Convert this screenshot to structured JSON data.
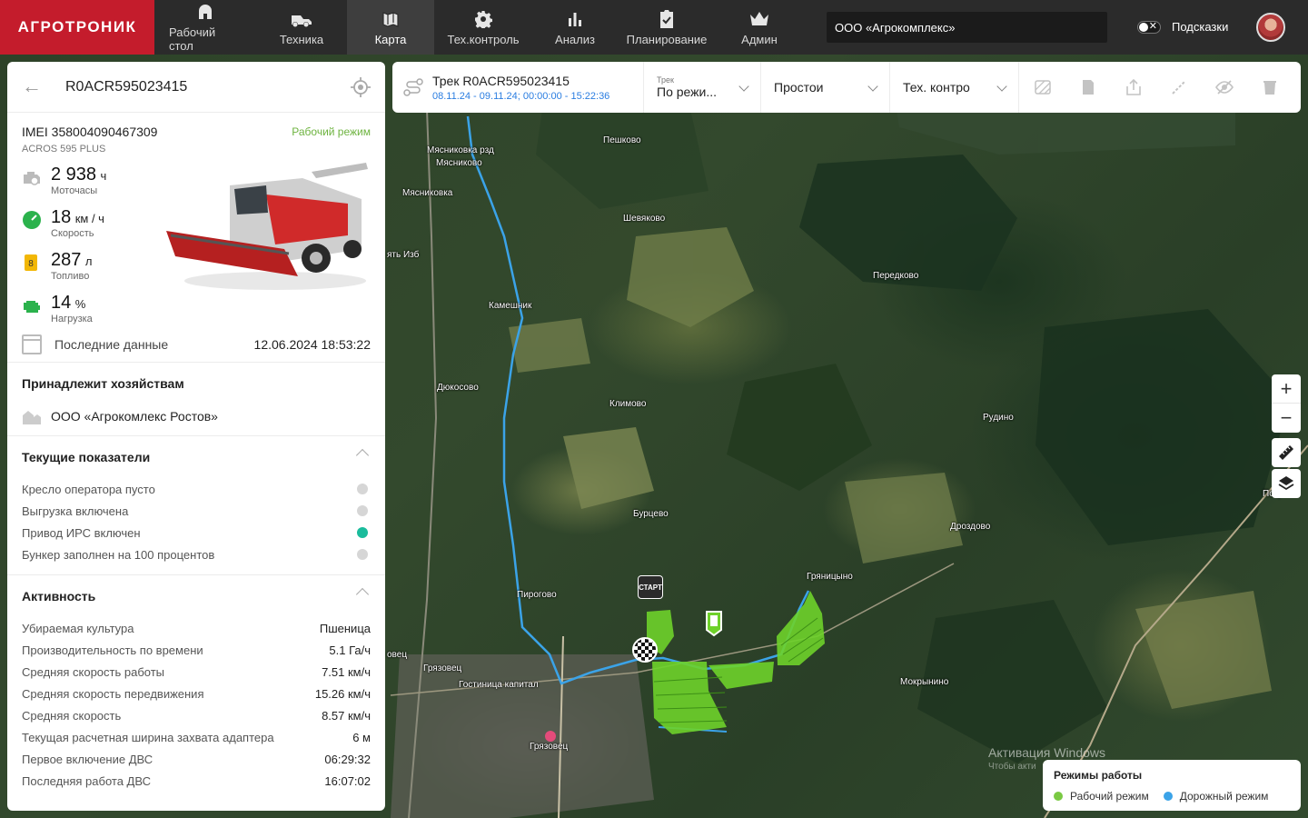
{
  "app": {
    "logo": "АГРОТРОНИК",
    "brand_color": "#c41c2c"
  },
  "nav": [
    {
      "label": "Рабочий стол",
      "icon": "home-icon",
      "active": false
    },
    {
      "label": "Техника",
      "icon": "tractor-icon",
      "active": false
    },
    {
      "label": "Карта",
      "icon": "map-icon",
      "active": true
    },
    {
      "label": "Тех.контроль",
      "icon": "gear-icon",
      "active": false
    },
    {
      "label": "Анализ",
      "icon": "bar-chart-icon",
      "active": false
    },
    {
      "label": "Планирование",
      "icon": "clipboard-check-icon",
      "active": false
    },
    {
      "label": "Админ",
      "icon": "crown-icon",
      "active": false
    }
  ],
  "header": {
    "company": "ООО «Агрокомплекс»",
    "hints_label": "Подсказки",
    "hints_enabled": false
  },
  "vehicle": {
    "title": "R0ACR595023415",
    "imei": "IMEI 358004090467309",
    "model": "ACROS 595 PLUS",
    "mode": "Рабочий режим",
    "stats": [
      {
        "value": "2 938",
        "unit": "ч",
        "label": "Моточасы",
        "icon": "engine-hours-icon"
      },
      {
        "value": "18",
        "unit": "км / ч",
        "label": "Скорость",
        "icon": "speedometer-icon"
      },
      {
        "value": "287",
        "unit": "л",
        "label": "Топливо",
        "icon": "fuel-icon"
      },
      {
        "value": "14",
        "unit": "%",
        "label": "Нагрузка",
        "icon": "engine-load-icon"
      }
    ],
    "last_data_label": "Последние данные",
    "last_data_value": "12.06.2024 18:53:22"
  },
  "farms": {
    "title": "Принадлежит хозяйствам",
    "items": [
      "ООО «Агрокомлекс Ростов»"
    ]
  },
  "indicators": {
    "title": "Текущие показатели",
    "items": [
      {
        "label": "Кресло оператора пусто",
        "on": false
      },
      {
        "label": "Выгрузка включена",
        "on": false
      },
      {
        "label": "Привод ИРС включен",
        "on": true
      },
      {
        "label": "Бункер заполнен на 100 процентов",
        "on": false
      }
    ]
  },
  "activity": {
    "title": "Активность",
    "rows": [
      {
        "label": "Убираемая культура",
        "value": "Пшеница"
      },
      {
        "label": "Производительность по времени",
        "value": "5.1 Га/ч"
      },
      {
        "label": "Средняя скорость работы",
        "value": "7.51 км/ч"
      },
      {
        "label": "Средняя скорость передвижения",
        "value": "15.26 км/ч"
      },
      {
        "label": "Средняя скорость",
        "value": "8.57 км/ч"
      },
      {
        "label": "Текущая расчетная ширина захвата адаптера",
        "value": "6 м"
      },
      {
        "label": "Первое включение ДВС",
        "value": "06:29:32"
      },
      {
        "label": "Последняя работа ДВС",
        "value": "16:07:02"
      }
    ]
  },
  "track": {
    "title": "Трек R0ACR595023415",
    "dates": "08.11.24 - 09.11.24; 00:00:00 - 15:22:36",
    "mode_caption": "Трек",
    "mode_value": "По режи...",
    "idle_value": "Простои",
    "techcontrol_value": "Тех. контро"
  },
  "legend": {
    "title": "Режимы работы",
    "items": [
      {
        "label": "Рабочий режим",
        "color": "#7ac943"
      },
      {
        "label": "Дорожный режим",
        "color": "#3ba3e8"
      }
    ]
  },
  "map": {
    "labels": [
      "Мясниковка рзд",
      "Мясниково",
      "Мясниковка",
      "Пешково",
      "Шевяково",
      "ять Изб",
      "Камешник",
      "Передково",
      "Дюкосово",
      "Климово",
      "Рудино",
      "Бурцево",
      "Дроздово",
      "Пирогово",
      "Гряницыно",
      "Грязовец",
      "Гостиница капитал",
      "Мокрынино",
      "Грязовец",
      "Покр",
      "овец"
    ],
    "start_label": "СТАРТ",
    "watermark": "Активация Windows",
    "watermark_sub": "Чтобы акти"
  }
}
